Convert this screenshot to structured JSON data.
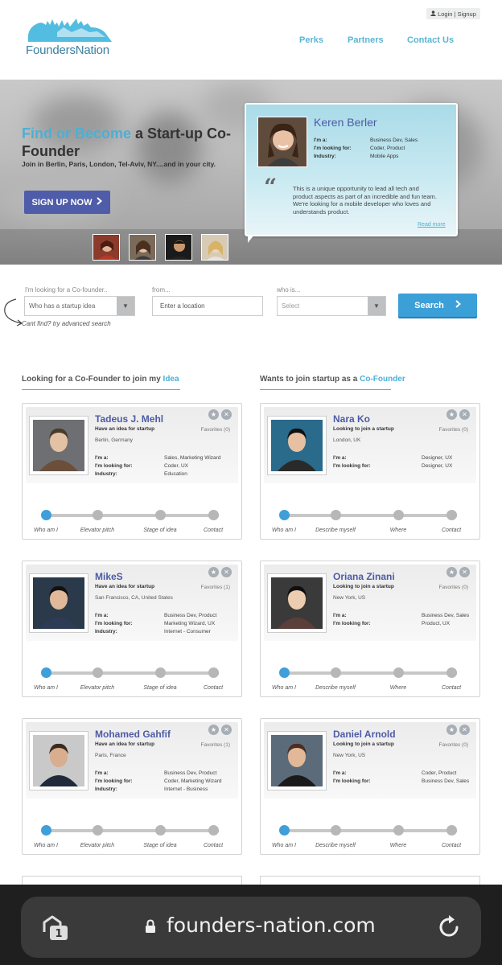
{
  "header": {
    "login": "Login | Signup",
    "logo_text": "FoundersNation",
    "nav": [
      "Perks",
      "Partners",
      "Contact Us"
    ]
  },
  "hero": {
    "title_accent": "Find or Become",
    "title_rest": " a Start-up Co-Founder",
    "subtitle": "Join in Berlin, Paris, London, Tel-Aviv, NY....and in your city.",
    "signup_label": "SIGN UP NOW"
  },
  "testimonial": {
    "name": "Keren Berler",
    "rows": [
      {
        "label": "I'm a:",
        "value": "Business Dev, Sales"
      },
      {
        "label": "I'm looking for:",
        "value": "Coder, Product"
      },
      {
        "label": "Industry:",
        "value": "Mobile Apps"
      }
    ],
    "quote": "This is a unique opportunity to lead all tech and product aspects as part of an incredible and fun team. We're looking for a mobile developer who loves and understands product.",
    "read_more": "Read more"
  },
  "search": {
    "label1": "I'm looking for a Co-founder..",
    "select1": "Who has a startup idea",
    "label2": "from...",
    "location_placeholder": "Enter a location",
    "label3": "who is...",
    "select3": "Select",
    "button": "Search",
    "cant_find": "Cant find? try advanced search"
  },
  "sections": {
    "left_prefix": "Looking for a Co-Founder to join my ",
    "left_accent": "Idea",
    "right_prefix": "Wants to join startup as a ",
    "right_accent": "Co-Founder"
  },
  "steps_left": [
    "Who am I",
    "Elevator pitch",
    "Stage of idea",
    "Contact"
  ],
  "steps_right": [
    "Who am I",
    "Describe myself",
    "Where",
    "Contact"
  ],
  "cards_left": [
    {
      "name": "Tadeus J. Mehl",
      "tag": "Have an idea for startup",
      "location": "Berlin, Germany",
      "fav": "Favorites (0)",
      "im_a": "Sales, Marketing Wizard",
      "looking": "Coder, UX",
      "industry": "Education"
    },
    {
      "name": "MikeS",
      "tag": "Have an idea for startup",
      "location": "San Francisco, CA, United States",
      "fav": "Favorites (1)",
      "im_a": "Business Dev, Product",
      "looking": "Marketing Wizard, UX",
      "industry": "Internet - Consumer"
    },
    {
      "name": "Mohamed Gahfif",
      "tag": "Have an idea for startup",
      "location": "Paris, France",
      "fav": "Favorites (1)",
      "im_a": "Business Dev, Product",
      "looking": "Coder, Marketing Wizard",
      "industry": "Internet - Business"
    }
  ],
  "cards_right": [
    {
      "name": "Nara Ko",
      "tag": "Looking to join a startup",
      "location": "London, UK",
      "fav": "Favorites (0)",
      "im_a": "Designer, UX",
      "looking": "Designer, UX"
    },
    {
      "name": "Oriana Zinani",
      "tag": "Looking to join a startup",
      "location": "New York, US",
      "fav": "Favorites (0)",
      "im_a": "Business Dev, Sales",
      "looking": "Product, UX"
    },
    {
      "name": "Daniel Arnold",
      "tag": "Looking to join a startup",
      "location": "New York, US",
      "fav": "Favorites (0)",
      "im_a": "Coder, Product",
      "looking": "Business Dev, Sales"
    }
  ],
  "labels": {
    "im_a": "I'm a:",
    "looking": "I'm looking for:",
    "industry": "Industry:"
  },
  "browser": {
    "url": "founders-nation.com",
    "tab_count": "1"
  }
}
